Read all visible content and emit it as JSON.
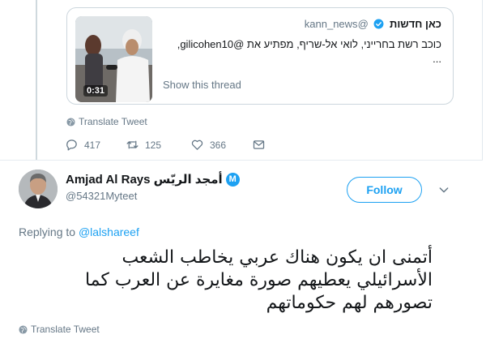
{
  "quoted_tweet": {
    "author_name": "כאן חדשות",
    "author_handle": "@kann_news",
    "body": "כוכב רשת בחרייני, לואי אל-שריף, מפתיע את @gilicohen10,",
    "ellipsis": "...",
    "show_thread": "Show this thread",
    "video_duration": "0:31",
    "translate": "Translate Tweet",
    "stats": {
      "replies": "417",
      "retweets": "125",
      "likes": "366"
    }
  },
  "reply_tweet": {
    "display_name": "Amjad Al Rays أمجد الريّس",
    "badge": "M",
    "handle": "@54321Myteet",
    "follow_label": "Follow",
    "replying_label": "Replying to",
    "replying_handle": "@lalshareef",
    "text_lines": [
      "أتمنى ان يكون هناك عربي يخاطب الشعب",
      "الأسرائيلي  يعطيهم صورة مغايرة عن العرب كما",
      "تصورهم لهم حكوماتهم"
    ],
    "translate": "Translate Tweet"
  },
  "colors": {
    "accent": "#1da1f2",
    "secondary_text": "#657786",
    "border": "#ccd6dd"
  }
}
